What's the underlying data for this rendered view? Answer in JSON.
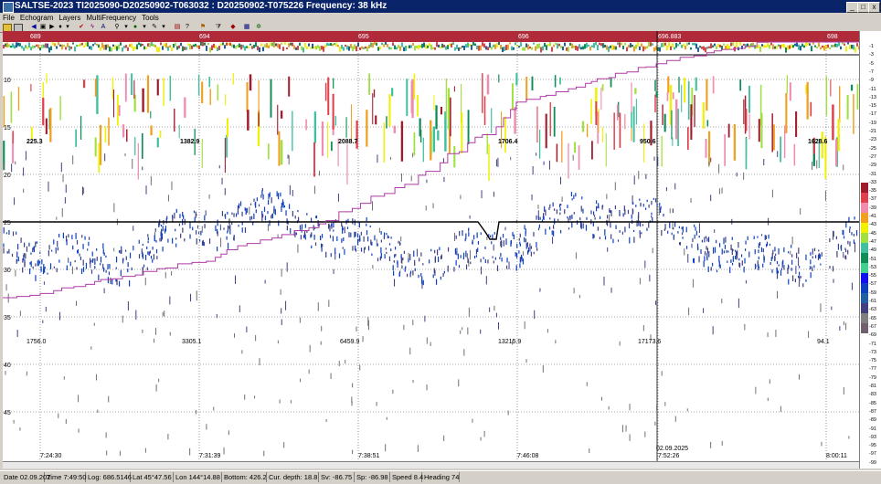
{
  "window": {
    "title": "SALTSE-2023  TI2025090-D20250902-T063032 : D20250902-T075226  Frequency: 38 kHz",
    "min": "_",
    "max": "□",
    "close": "x"
  },
  "menu": [
    "File",
    "Echogram",
    "Layers",
    "MultiFrequency",
    "Tools"
  ],
  "echogram": {
    "depth_ticks": [
      "10",
      "15",
      "20",
      "25",
      "30",
      "35",
      "40",
      "45"
    ],
    "time_labels": [
      "7:24:30",
      "7:31:39",
      "7:38:51",
      "7:46:08",
      "7:52:26",
      "8:00:11"
    ],
    "date_label": "02.09.2025",
    "upper_values": [
      "225.3",
      "1382.9",
      "2088.7",
      "1706.4",
      "950.6",
      "1628.6"
    ],
    "lower_values": [
      "1756.0",
      "3305.1",
      "6459.9",
      "13215.9",
      "17173.6",
      "94.1"
    ],
    "interval_labels": [
      "689",
      "694",
      "695",
      "696",
      "696.883",
      "698"
    ],
    "colors": {
      "bottom_line": "#000000",
      "cumulative_line": "#b03aa6",
      "grid": "#555555",
      "header_band": "#b02a3a"
    }
  },
  "color_scale": {
    "labels": [
      "-1",
      "-3",
      "-5",
      "-7",
      "-9",
      "-11",
      "-13",
      "-15",
      "-17",
      "-19",
      "-21",
      "-23",
      "-25",
      "-27",
      "-29",
      "-31",
      "-33",
      "-35",
      "-37",
      "-39",
      "-41",
      "-43",
      "-45",
      "-47",
      "-49",
      "-51",
      "-53",
      "-55",
      "-57",
      "-59",
      "-61",
      "-63",
      "-65",
      "-67",
      "-69",
      "-71",
      "-73",
      "-75",
      "-77",
      "-79",
      "-81",
      "-83",
      "-85",
      "-87",
      "-89",
      "-91",
      "-93",
      "-95",
      "-97",
      "-99"
    ],
    "swatches": [
      "#a01c2c",
      "#e0404a",
      "#f08cb0",
      "#f0a020",
      "#f0f000",
      "#a0e040",
      "#40c0a0",
      "#108c58",
      "#40d090",
      "#1010f0",
      "#1040c0",
      "#2060a0",
      "#404080",
      "#808080",
      "#706070"
    ]
  },
  "status": {
    "date": "Date 02.09.202",
    "time": "Time 7:49:50",
    "log": "Log: 686.5146",
    "lat": "Lat 45°47.56",
    "lon": "Lon 144°14.88",
    "bottom": "Bottom: 426.2",
    "cur_depth": "Cur. depth: 18.8",
    "sv": "Sv: -86.75",
    "sp": "Sp: -86.98",
    "speed": "Speed 8.4",
    "heading": "Heading 74"
  }
}
